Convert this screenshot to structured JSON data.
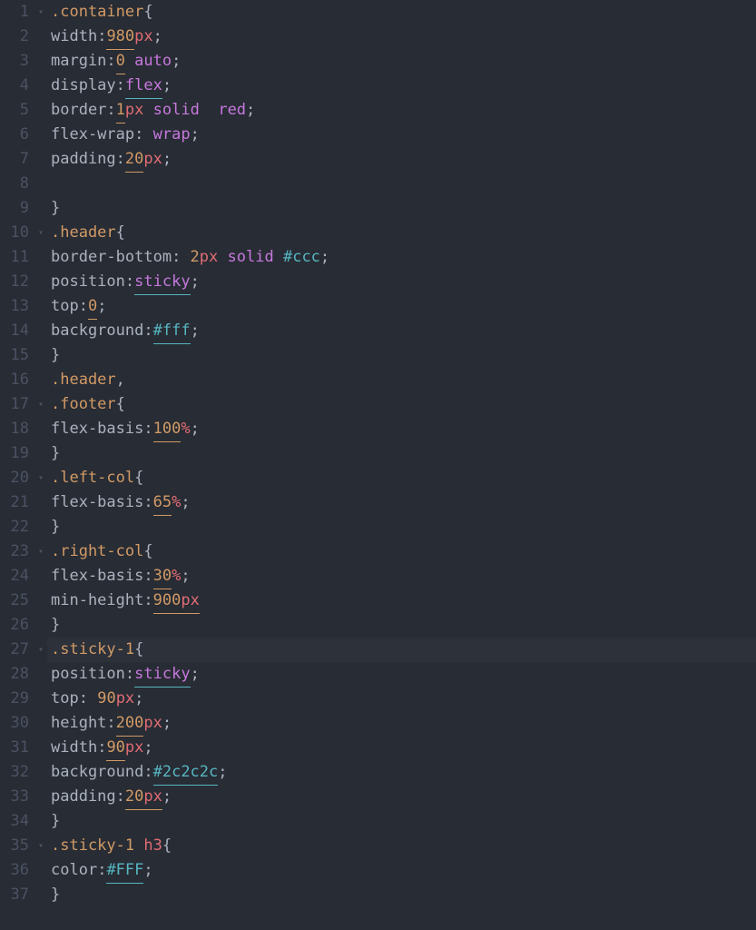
{
  "lineCount": 37,
  "highlightedLine": 27,
  "foldMarkers": {
    "1": "▾",
    "10": "▾",
    "17": "▾",
    "20": "▾",
    "23": "▾",
    "27": "▾",
    "35": "▾"
  },
  "lines": [
    {
      "n": 1,
      "tokens": [
        {
          "t": ".container",
          "c": "sel"
        },
        {
          "t": "{",
          "c": "brace"
        }
      ]
    },
    {
      "n": 2,
      "indent": 1,
      "tokens": [
        {
          "t": "width",
          "c": "prop"
        },
        {
          "t": ":",
          "c": "punc"
        },
        {
          "t": "980",
          "c": "num",
          "u": true
        },
        {
          "t": "px",
          "c": "unit"
        },
        {
          "t": ";",
          "c": "punc"
        }
      ]
    },
    {
      "n": 3,
      "indent": 1,
      "tokens": [
        {
          "t": "margin",
          "c": "prop"
        },
        {
          "t": ":",
          "c": "punc"
        },
        {
          "t": "0",
          "c": "num",
          "u": true
        },
        {
          "t": " ",
          "c": "prop"
        },
        {
          "t": "auto",
          "c": "kw"
        },
        {
          "t": ";",
          "c": "punc"
        }
      ]
    },
    {
      "n": 4,
      "indent": 1,
      "tokens": [
        {
          "t": "display",
          "c": "prop"
        },
        {
          "t": ":",
          "c": "punc"
        },
        {
          "t": "flex",
          "c": "kw",
          "u": true
        },
        {
          "t": ";",
          "c": "punc"
        }
      ]
    },
    {
      "n": 5,
      "indent": 1,
      "tokens": [
        {
          "t": "border",
          "c": "prop"
        },
        {
          "t": ":",
          "c": "punc"
        },
        {
          "t": "1",
          "c": "num",
          "u": true
        },
        {
          "t": "px",
          "c": "unit"
        },
        {
          "t": " ",
          "c": "prop"
        },
        {
          "t": "solid",
          "c": "kw"
        },
        {
          "t": "  ",
          "c": "prop"
        },
        {
          "t": "red",
          "c": "kw"
        },
        {
          "t": ";",
          "c": "punc"
        }
      ]
    },
    {
      "n": 6,
      "indent": 1,
      "tokens": [
        {
          "t": "flex-wrap",
          "c": "prop"
        },
        {
          "t": ": ",
          "c": "punc"
        },
        {
          "t": "wrap",
          "c": "kw"
        },
        {
          "t": ";",
          "c": "punc"
        }
      ]
    },
    {
      "n": 7,
      "indent": 1,
      "tokens": [
        {
          "t": "padding",
          "c": "prop"
        },
        {
          "t": ":",
          "c": "punc"
        },
        {
          "t": "20",
          "c": "num",
          "u": true
        },
        {
          "t": "px",
          "c": "unit"
        },
        {
          "t": ";",
          "c": "punc"
        }
      ]
    },
    {
      "n": 8,
      "tokens": []
    },
    {
      "n": 9,
      "tokens": [
        {
          "t": "}",
          "c": "brace"
        }
      ]
    },
    {
      "n": 10,
      "tokens": [
        {
          "t": ".header",
          "c": "sel"
        },
        {
          "t": "{",
          "c": "brace"
        }
      ]
    },
    {
      "n": 11,
      "indent": 1,
      "tokens": [
        {
          "t": "border-bottom",
          "c": "prop"
        },
        {
          "t": ": ",
          "c": "punc"
        },
        {
          "t": "2",
          "c": "num"
        },
        {
          "t": "px",
          "c": "unit"
        },
        {
          "t": " ",
          "c": "prop"
        },
        {
          "t": "solid",
          "c": "kw"
        },
        {
          "t": " ",
          "c": "prop"
        },
        {
          "t": "#ccc",
          "c": "hex"
        },
        {
          "t": ";",
          "c": "punc"
        }
      ]
    },
    {
      "n": 12,
      "indent": 1,
      "tokens": [
        {
          "t": "position",
          "c": "prop"
        },
        {
          "t": ":",
          "c": "punc"
        },
        {
          "t": "sticky",
          "c": "kw",
          "u": true
        },
        {
          "t": ";",
          "c": "punc"
        }
      ]
    },
    {
      "n": 13,
      "indent": 1,
      "tokens": [
        {
          "t": "top",
          "c": "prop"
        },
        {
          "t": ":",
          "c": "punc"
        },
        {
          "t": "0",
          "c": "num",
          "u": true
        },
        {
          "t": ";",
          "c": "punc"
        }
      ]
    },
    {
      "n": 14,
      "indent": 1,
      "tokens": [
        {
          "t": "background",
          "c": "prop"
        },
        {
          "t": ":",
          "c": "punc"
        },
        {
          "t": "#fff",
          "c": "hex",
          "u": true
        },
        {
          "t": ";",
          "c": "punc"
        }
      ]
    },
    {
      "n": 15,
      "tokens": [
        {
          "t": "}",
          "c": "brace"
        }
      ]
    },
    {
      "n": 16,
      "tokens": [
        {
          "t": ".header",
          "c": "sel"
        },
        {
          "t": ",",
          "c": "punc"
        }
      ]
    },
    {
      "n": 17,
      "tokens": [
        {
          "t": ".footer",
          "c": "sel"
        },
        {
          "t": "{",
          "c": "brace"
        }
      ]
    },
    {
      "n": 18,
      "indent": 1,
      "tokens": [
        {
          "t": "flex-basis",
          "c": "prop"
        },
        {
          "t": ":",
          "c": "punc"
        },
        {
          "t": "100",
          "c": "num",
          "u": true
        },
        {
          "t": "%",
          "c": "unit"
        },
        {
          "t": ";",
          "c": "punc"
        }
      ]
    },
    {
      "n": 19,
      "tokens": [
        {
          "t": "}",
          "c": "brace"
        }
      ]
    },
    {
      "n": 20,
      "tokens": [
        {
          "t": ".left-col",
          "c": "sel"
        },
        {
          "t": "{",
          "c": "brace"
        }
      ]
    },
    {
      "n": 21,
      "indent": 1,
      "tokens": [
        {
          "t": "flex-basis",
          "c": "prop"
        },
        {
          "t": ":",
          "c": "punc"
        },
        {
          "t": "65",
          "c": "num",
          "u": true
        },
        {
          "t": "%",
          "c": "unit"
        },
        {
          "t": ";",
          "c": "punc"
        }
      ]
    },
    {
      "n": 22,
      "tokens": [
        {
          "t": "}",
          "c": "brace"
        }
      ]
    },
    {
      "n": 23,
      "tokens": [
        {
          "t": ".right-col",
          "c": "sel"
        },
        {
          "t": "{",
          "c": "brace"
        }
      ]
    },
    {
      "n": 24,
      "indent": 1,
      "tokens": [
        {
          "t": "flex-basis",
          "c": "prop"
        },
        {
          "t": ":",
          "c": "punc"
        },
        {
          "t": "30",
          "c": "num",
          "u": true
        },
        {
          "t": "%",
          "c": "unit"
        },
        {
          "t": ";",
          "c": "punc"
        }
      ]
    },
    {
      "n": 25,
      "indent": 1,
      "tokens": [
        {
          "t": "min-height",
          "c": "prop"
        },
        {
          "t": ":",
          "c": "punc"
        },
        {
          "t": "900",
          "c": "num",
          "u": true
        },
        {
          "t": "px",
          "c": "unit",
          "u": true
        }
      ]
    },
    {
      "n": 26,
      "tokens": [
        {
          "t": "}",
          "c": "brace"
        }
      ]
    },
    {
      "n": 27,
      "hl": true,
      "tokens": [
        {
          "t": ".sticky-1",
          "c": "sel"
        },
        {
          "t": "{",
          "c": "brace"
        }
      ]
    },
    {
      "n": 28,
      "indent": 1,
      "tokens": [
        {
          "t": "position",
          "c": "prop"
        },
        {
          "t": ":",
          "c": "punc"
        },
        {
          "t": "sticky",
          "c": "kw",
          "u": true
        },
        {
          "t": ";",
          "c": "punc"
        }
      ]
    },
    {
      "n": 29,
      "indent": 1,
      "tokens": [
        {
          "t": "top",
          "c": "prop"
        },
        {
          "t": ": ",
          "c": "punc"
        },
        {
          "t": "90",
          "c": "num"
        },
        {
          "t": "px",
          "c": "unit"
        },
        {
          "t": ";",
          "c": "punc"
        }
      ]
    },
    {
      "n": 30,
      "indent": 1,
      "tokens": [
        {
          "t": "height",
          "c": "prop"
        },
        {
          "t": ":",
          "c": "punc"
        },
        {
          "t": "200",
          "c": "num",
          "u": true
        },
        {
          "t": "px",
          "c": "unit"
        },
        {
          "t": ";",
          "c": "punc"
        }
      ]
    },
    {
      "n": 31,
      "indent": 1,
      "tokens": [
        {
          "t": "width",
          "c": "prop"
        },
        {
          "t": ":",
          "c": "punc"
        },
        {
          "t": "90",
          "c": "num",
          "u": true
        },
        {
          "t": "px",
          "c": "unit"
        },
        {
          "t": ";",
          "c": "punc"
        }
      ]
    },
    {
      "n": 32,
      "indent": 1,
      "tokens": [
        {
          "t": "background",
          "c": "prop"
        },
        {
          "t": ":",
          "c": "punc"
        },
        {
          "t": "#2c2c2c",
          "c": "hex",
          "u": true
        },
        {
          "t": ";",
          "c": "punc"
        }
      ]
    },
    {
      "n": 33,
      "indent": 1,
      "tokens": [
        {
          "t": "padding",
          "c": "prop"
        },
        {
          "t": ":",
          "c": "punc"
        },
        {
          "t": "20",
          "c": "num",
          "u": true
        },
        {
          "t": "px",
          "c": "unit",
          "u": true
        },
        {
          "t": ";",
          "c": "punc"
        }
      ]
    },
    {
      "n": 34,
      "tokens": [
        {
          "t": "}",
          "c": "brace"
        }
      ]
    },
    {
      "n": 35,
      "tokens": [
        {
          "t": ".sticky-1",
          "c": "sel"
        },
        {
          "t": " ",
          "c": "prop"
        },
        {
          "t": "h3",
          "c": "tag"
        },
        {
          "t": "{",
          "c": "brace"
        }
      ]
    },
    {
      "n": 36,
      "indent": 1,
      "tokens": [
        {
          "t": "color",
          "c": "prop"
        },
        {
          "t": ":",
          "c": "punc"
        },
        {
          "t": "#FFF",
          "c": "hex",
          "u": true
        },
        {
          "t": ";",
          "c": "punc"
        }
      ]
    },
    {
      "n": 37,
      "tokens": [
        {
          "t": "}",
          "c": "brace"
        }
      ]
    }
  ]
}
